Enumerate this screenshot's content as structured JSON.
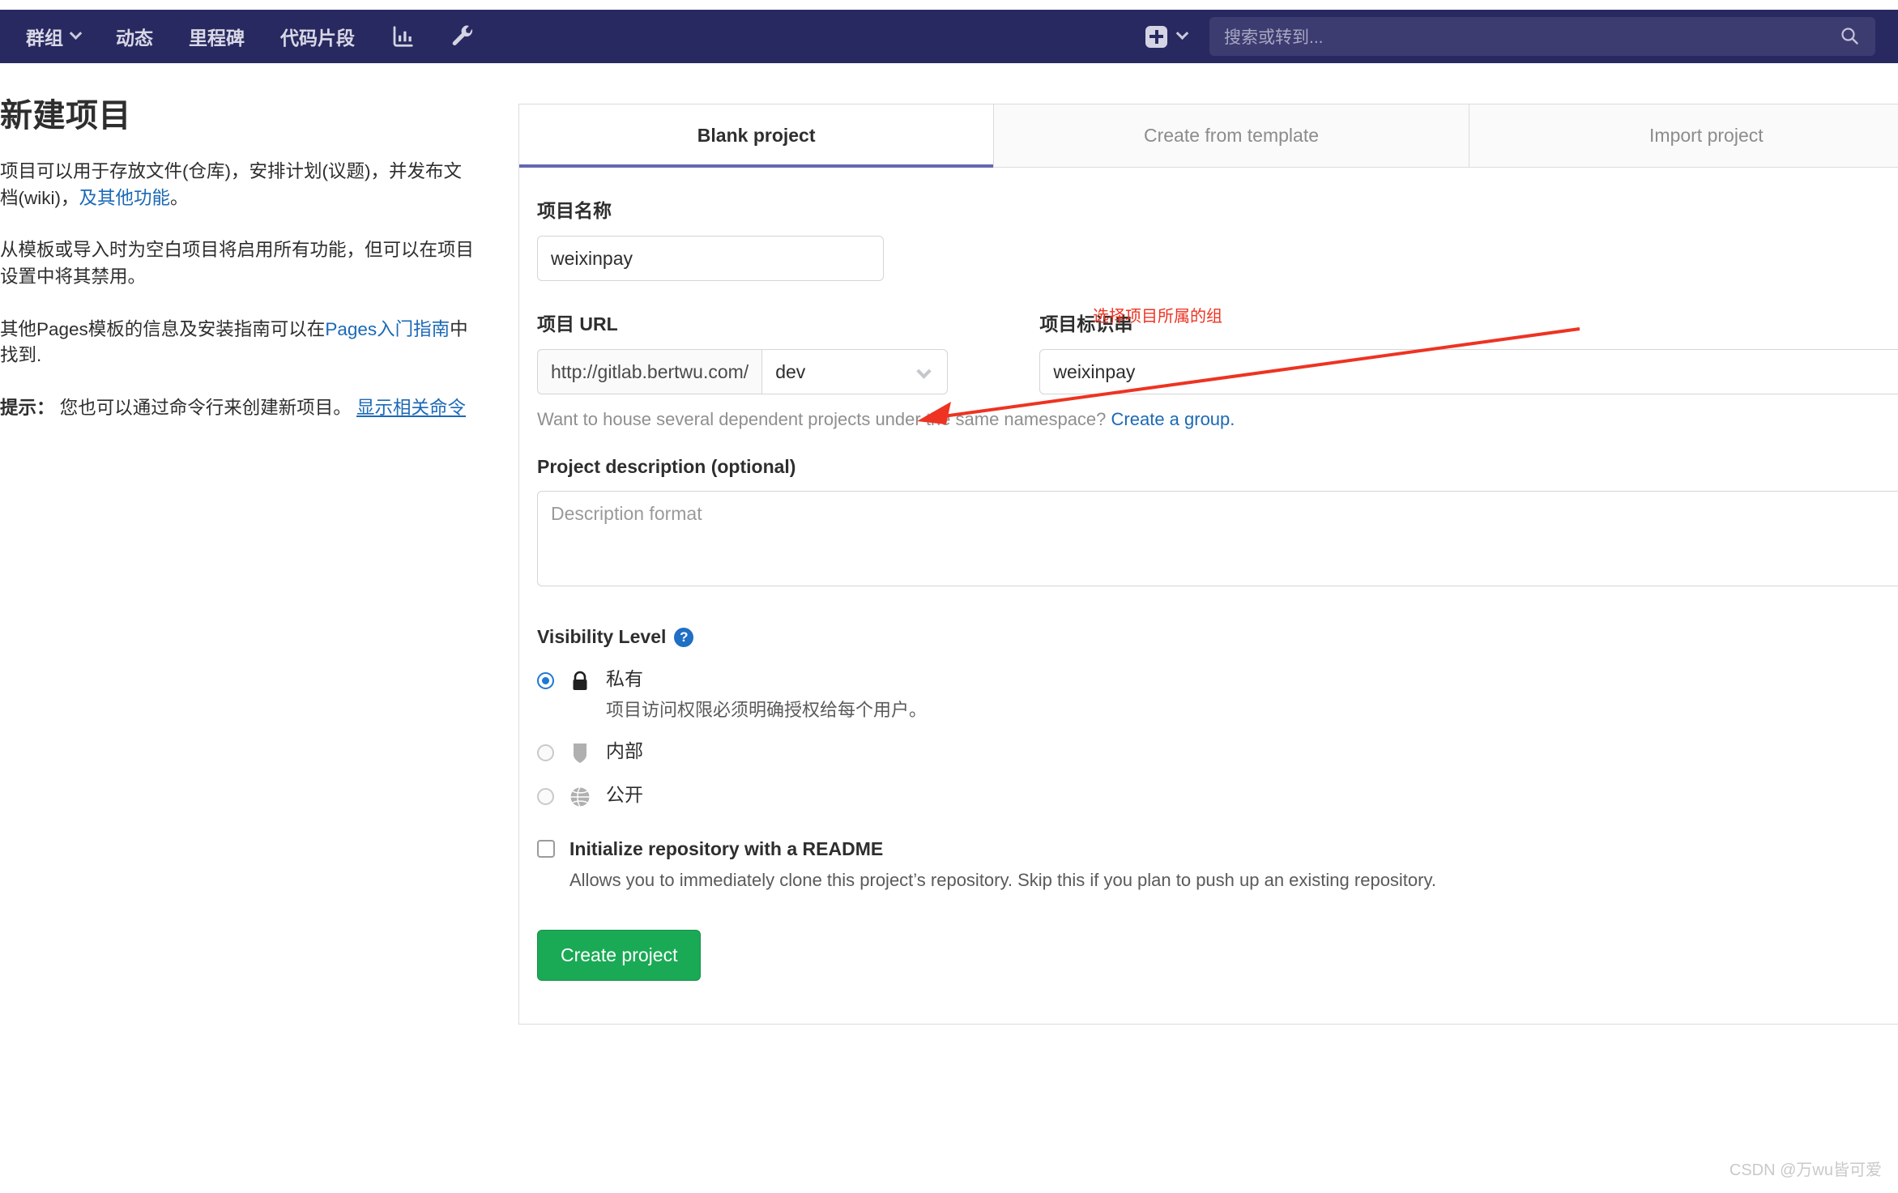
{
  "navbar": {
    "items": [
      {
        "label": "群组",
        "has_caret": true
      },
      {
        "label": "动态",
        "has_caret": false
      },
      {
        "label": "里程碑",
        "has_caret": false
      },
      {
        "label": "代码片段",
        "has_caret": false
      }
    ],
    "icons": [
      "chart-icon",
      "wrench-icon"
    ],
    "plus_icon": "plus-square-icon",
    "plus_caret": "chevron-down-icon",
    "search_placeholder": "搜索或转到...",
    "search_value": "",
    "search_icon": "search-icon",
    "background": "#292961",
    "search_background": "#3c3c70"
  },
  "sidebar": {
    "title": "新建项目",
    "paragraph1_part1": "项目可以用于存放文件(仓库)，安排计划(议题)，并发布文档(wiki)，",
    "paragraph1_link": "及其他功能",
    "paragraph1_part2": "。",
    "paragraph2": "从模板或导入时为空白项目将启用所有功能，但可以在项目设置中将其禁用。",
    "paragraph3_part1": "其他Pages模板的信息及安装指南可以在",
    "paragraph3_link": "Pages入门指南",
    "paragraph3_part2": "中找到.",
    "tip_label": "提示：",
    "tip_text": " 您也可以通过命令行来创建新项目。 ",
    "tip_link": "显示相关命令",
    "link_color": "#1b69b6"
  },
  "tabs": [
    {
      "label": "Blank project",
      "active": true
    },
    {
      "label": "Create from template",
      "active": false
    },
    {
      "label": "Import project",
      "active": false
    }
  ],
  "form": {
    "project_name_label": "项目名称",
    "project_name_value": "weixinpay",
    "project_url_label": "项目 URL",
    "url_prefix": "http://gitlab.bertwu.com/",
    "url_namespace_value": "dev",
    "url_namespace_caret": "chevron-down-icon",
    "project_slug_label": "项目标识串",
    "project_slug_value": "weixinpay",
    "namespace_hint_text": "Want to house several dependent projects under the same namespace? ",
    "namespace_hint_link": "Create a group.",
    "description_label": "Project description (optional)",
    "description_placeholder": "Description format",
    "description_value": "",
    "visibility_label": "Visibility Level",
    "visibility_help_icon": "question-circle-icon",
    "visibility_options": [
      {
        "name": "私有",
        "icon": "lock-icon",
        "description": "项目访问权限必须明确授权给每个用户。",
        "selected": true
      },
      {
        "name": "内部",
        "icon": "shield-icon",
        "description": "",
        "selected": false
      },
      {
        "name": "公开",
        "icon": "globe-icon",
        "description": "",
        "selected": false
      }
    ],
    "readme_label": "Initialize repository with a README",
    "readme_checked": false,
    "readme_description": "Allows you to immediately clone this project’s repository. Skip this if you plan to push up an existing repository.",
    "create_button_label": "Create project",
    "create_button_color": "#1aaa55"
  },
  "annotation": {
    "text": "选择项目所属的组",
    "color": "#ee3322"
  },
  "watermark": "CSDN @万wu皆可爱"
}
